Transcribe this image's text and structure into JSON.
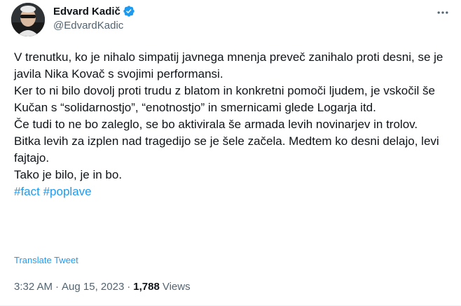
{
  "author": {
    "display_name": "Edvard Kadič",
    "handle": "@EdvardKadic",
    "verified_color": "#1d9bf0"
  },
  "tweet": {
    "lines": [
      "V trenutku, ko je nihalo simpatij javnega mnenja preveč zanihalo proti desni, se je javila Nika Kovač s svojimi performansi.",
      "Ker to ni bilo dovolj proti trudu z blatom in konkretni pomoči ljudem, je vskočil še Kučan s “solidarnostjo”, “enotnostjo” in smernicami glede Logarja itd.",
      "Če tudi to ne bo zaleglo, se bo aktivirala še armada levih novinarjev in trolov.",
      "Bitka levih za izplen nad tragedijo se je šele začela. Medtem ko desni delajo, levi fajtajo.",
      "Tako je bilo, je in bo."
    ],
    "hashtags": [
      "#fact",
      "#poplave"
    ],
    "translate_label": "Translate Tweet"
  },
  "meta": {
    "time": "3:32 AM",
    "separator": "·",
    "date": "Aug 15, 2023",
    "views_count": "1,788",
    "views_label": "Views"
  },
  "icons": {
    "verified": "verified-badge-icon",
    "more": "more-options-icon"
  },
  "colors": {
    "accent": "#1d9bf0",
    "text": "#0f1419",
    "secondary": "#536471"
  }
}
